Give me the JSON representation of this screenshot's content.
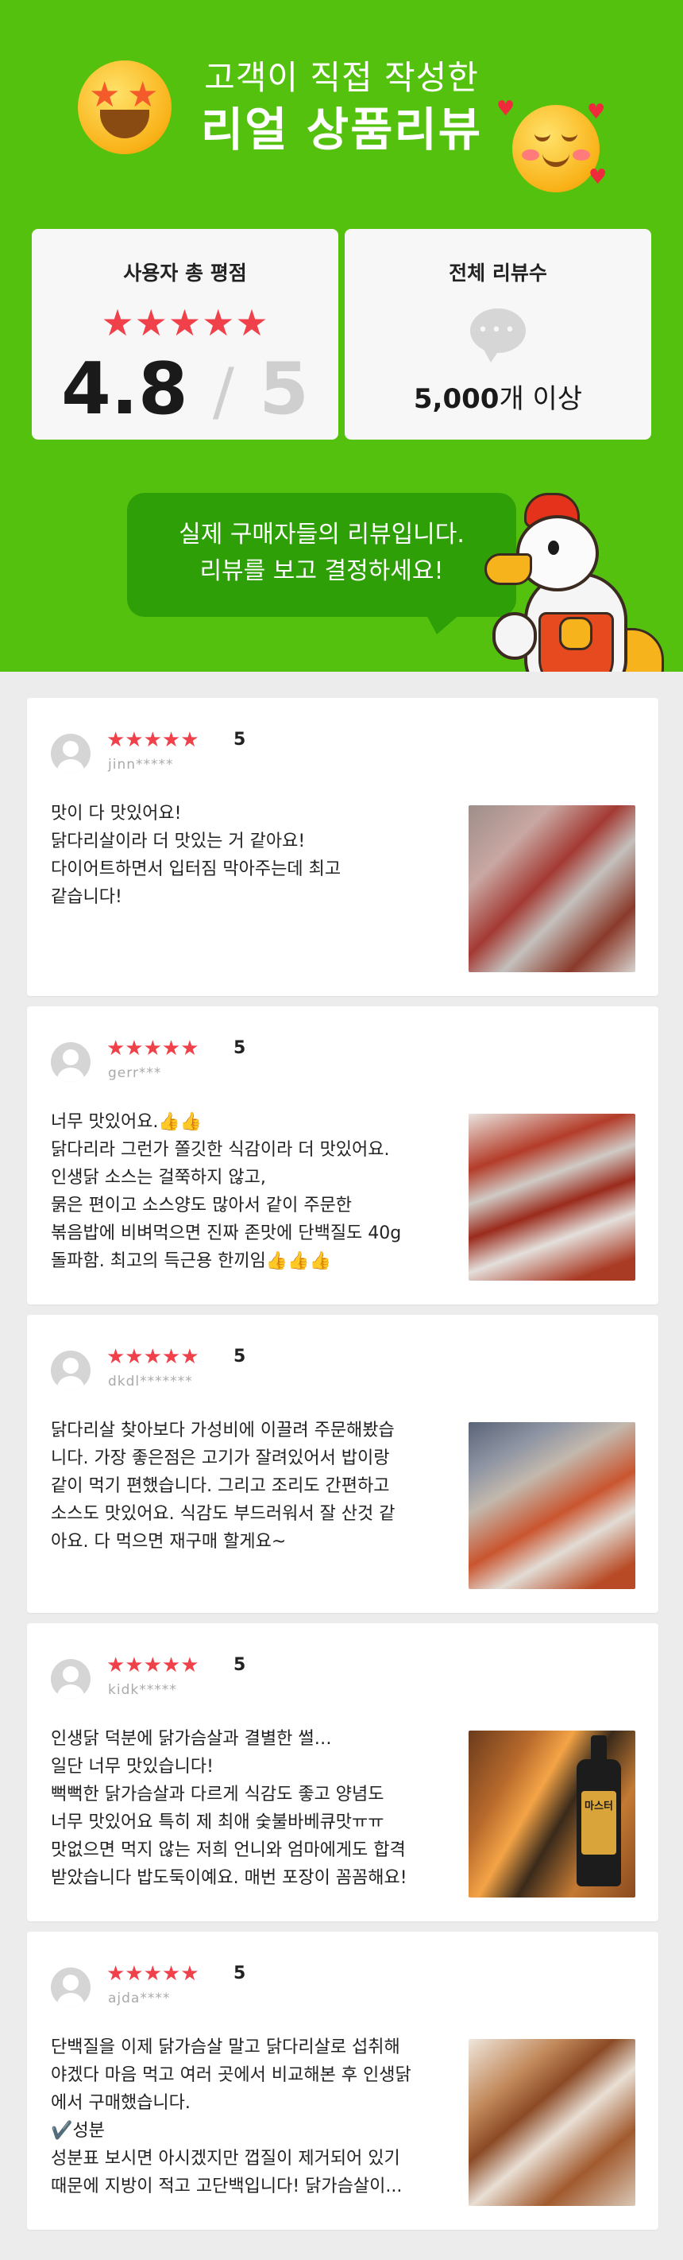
{
  "header": {
    "subtitle": "고객이 직접 작성한",
    "title": "리얼 상품리뷰"
  },
  "rating_card": {
    "label": "사용자 총 평점",
    "stars": "★★★★★",
    "score": "4.8",
    "separator": "/",
    "max": "5",
    "star_color": "#f0414b"
  },
  "count_card": {
    "label": "전체 리뷰수",
    "icon": "chat-bubble-icon",
    "count": "5,000",
    "suffix": "개 이상"
  },
  "speech": {
    "line1": "실제 구매자들의 리뷰입니다.",
    "line2": "리뷰를 보고 결정하세요!"
  },
  "colors": {
    "brand_green": "#54c10f",
    "speech_green": "#2f9f08",
    "star_red": "#f0414b",
    "background": "#ececec"
  },
  "reviews": [
    {
      "stars": "★★★★★",
      "score": "5",
      "user": "jinn*****",
      "text": "맛이 다 맛있어요!\n닭다리살이라 더 맛있는 거 같아요!\n다이어트하면서 입터짐 막아주는데 최고\n같습니다!"
    },
    {
      "stars": "★★★★★",
      "score": "5",
      "user": "gerr***",
      "text": "너무 맛있어요.👍👍\n닭다리라 그런가 쫄깃한 식감이라 더 맛있어요.\n인생닭 소스는 걸쭉하지 않고,\n묽은 편이고 소스양도 많아서 같이 주문한\n볶음밥에 비벼먹으면 진짜 존맛에 단백질도 40g\n돌파함. 최고의 득근용 한끼임👍👍👍"
    },
    {
      "stars": "★★★★★",
      "score": "5",
      "user": "dkdl*******",
      "text": "닭다리살 찾아보다 가성비에 이끌려 주문해봤습\n니다. 가장 좋은점은 고기가 잘려있어서 밥이랑\n같이 먹기 편했습니다. 그리고 조리도 간편하고\n소스도 맛있어요. 식감도 부드러워서 잘 산것 같\n아요. 다 먹으면 재구매 할게요~"
    },
    {
      "stars": "★★★★★",
      "score": "5",
      "user": "kidk*****",
      "text": "인생닭 덕분에 닭가슴살과 결별한 썰…\n일단 너무 맛있습니다!\n뻑뻑한 닭가슴살과 다르게 식감도 좋고 양념도\n너무 맛있어요 특히 제 최애 숯불바베큐맛ㅠㅠ\n맛없으면 먹지 않는 저희 언니와 엄마에게도 합격\n받았습니다 밥도둑이예요. 매번 포장이 꼼꼼해요!"
    },
    {
      "stars": "★★★★★",
      "score": "5",
      "user": "ajda****",
      "text": "단백질을 이제 닭가슴살 말고 닭다리살로 섭취해\n야겠다 마음 먹고 여러 곳에서 비교해본 후 인생닭\n에서 구매했습니다.\n✔️성분\n성분표 보시면 아시겠지만 껍질이 제거되어 있기\n때문에 지방이 적고 고단백입니다! 닭가슴살이..."
    }
  ],
  "photo4_label": "마스터"
}
